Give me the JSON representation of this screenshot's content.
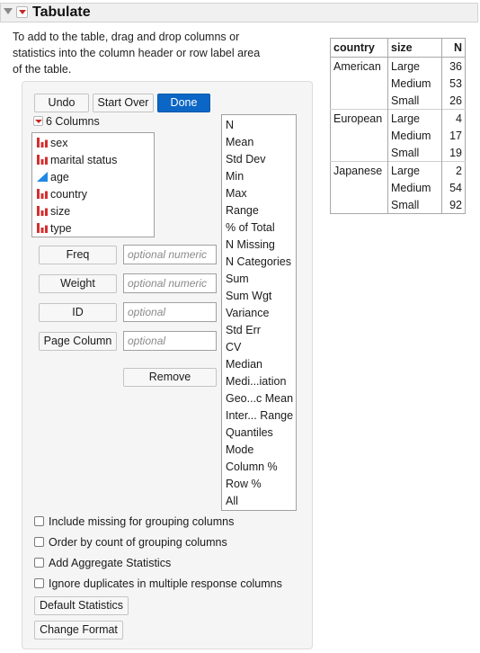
{
  "header": {
    "title": "Tabulate"
  },
  "instructions": [
    "To add to the table, drag and drop columns or",
    "statistics into the column header or row label area",
    "of the table."
  ],
  "toolbar": {
    "undo": "Undo",
    "start_over": "Start Over",
    "done": "Done"
  },
  "columns": {
    "header": "6 Columns",
    "items": [
      {
        "name": "sex",
        "icon": "bar-chart-icon",
        "color": "#d32f2f"
      },
      {
        "name": "marital status",
        "icon": "bar-chart-icon",
        "color": "#d32f2f"
      },
      {
        "name": "age",
        "icon": "ramp-triangle-icon",
        "color": "#1e88e5"
      },
      {
        "name": "country",
        "icon": "bar-chart-icon",
        "color": "#d32f2f"
      },
      {
        "name": "size",
        "icon": "bar-chart-icon",
        "color": "#d32f2f"
      },
      {
        "name": "type",
        "icon": "bar-chart-icon",
        "color": "#d32f2f"
      }
    ]
  },
  "roles": [
    {
      "label": "Freq",
      "placeholder": "optional numeric"
    },
    {
      "label": "Weight",
      "placeholder": "optional numeric"
    },
    {
      "label": "ID",
      "placeholder": "optional"
    },
    {
      "label": "Page Column",
      "placeholder": "optional"
    }
  ],
  "remove_label": "Remove",
  "statistics": [
    "N",
    "Mean",
    "Std Dev",
    "Min",
    "Max",
    "Range",
    "% of Total",
    "N Missing",
    "N Categories",
    "Sum",
    "Sum Wgt",
    "Variance",
    "Std Err",
    "CV",
    "Median",
    "Medi...iation",
    "Geo...c Mean",
    "Inter... Range",
    "Quantiles",
    "Mode",
    "Column %",
    "Row %",
    "All"
  ],
  "options": [
    "Include missing for grouping columns",
    "Order by count of grouping columns",
    "Add Aggregate Statistics",
    "Ignore duplicates in multiple response columns"
  ],
  "bottom_buttons": {
    "default_statistics": "Default Statistics",
    "change_format": "Change Format"
  },
  "table": {
    "headers": [
      "country",
      "size",
      "N"
    ],
    "groups": [
      {
        "country": "American",
        "rows": [
          {
            "size": "Large",
            "n": "36"
          },
          {
            "size": "Medium",
            "n": "53"
          },
          {
            "size": "Small",
            "n": "26"
          }
        ]
      },
      {
        "country": "European",
        "rows": [
          {
            "size": "Large",
            "n": "4"
          },
          {
            "size": "Medium",
            "n": "17"
          },
          {
            "size": "Small",
            "n": "19"
          }
        ]
      },
      {
        "country": "Japanese",
        "rows": [
          {
            "size": "Large",
            "n": "2"
          },
          {
            "size": "Medium",
            "n": "54"
          },
          {
            "size": "Small",
            "n": "92"
          }
        ]
      }
    ]
  },
  "colors": {
    "accent": "#0c66c5",
    "nominal_icon": "#d32f2f",
    "continuous_icon": "#1e88e5",
    "menu_triangle": "#c62828"
  }
}
